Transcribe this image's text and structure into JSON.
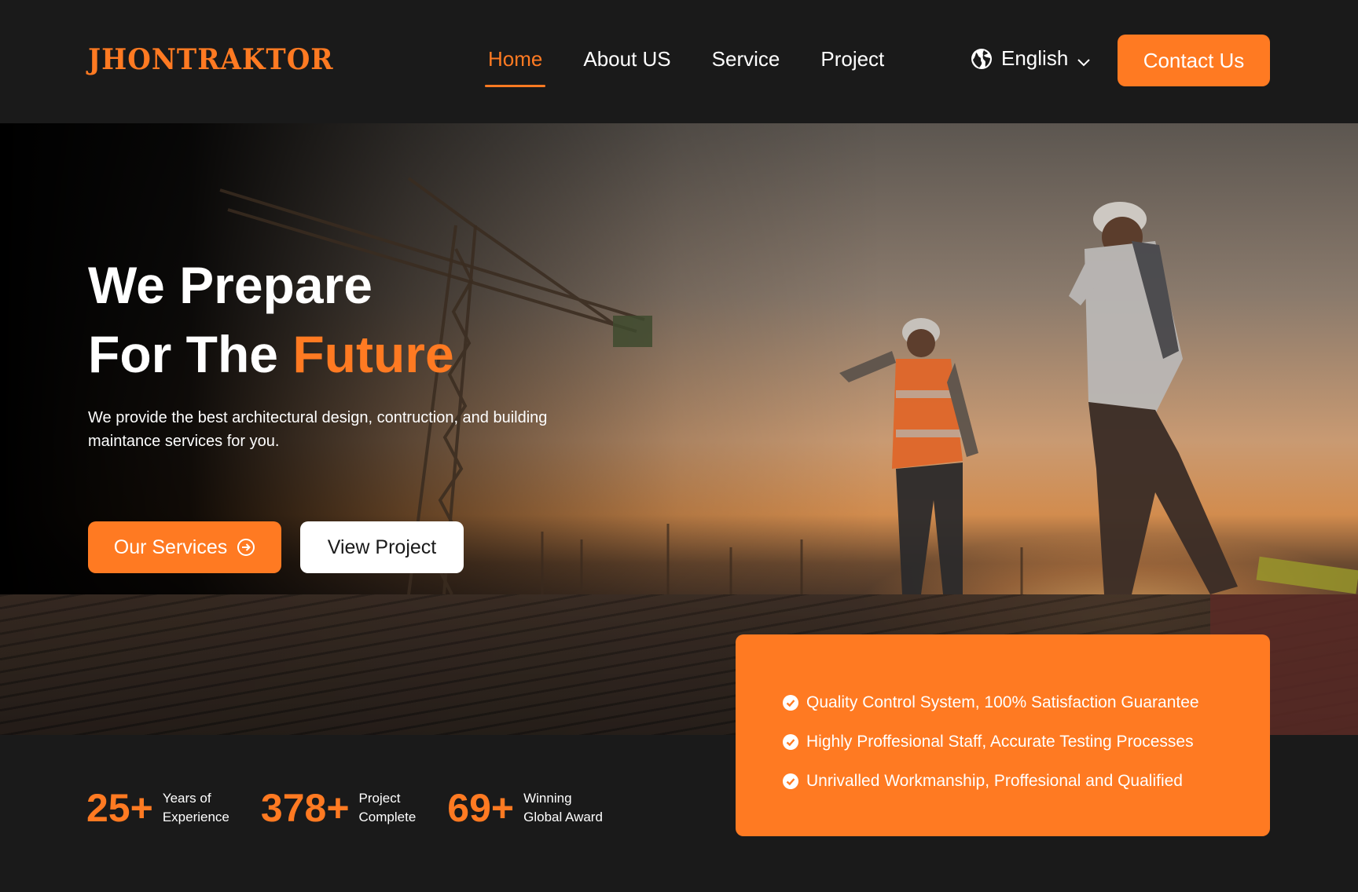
{
  "brand": {
    "logo": "JHONTRAKTOR",
    "accent_color": "#ff7a22",
    "background_color": "#1a1a1a"
  },
  "nav": {
    "items": [
      {
        "label": "Home",
        "active": true
      },
      {
        "label": "About US",
        "active": false
      },
      {
        "label": "Service",
        "active": false
      },
      {
        "label": "Project",
        "active": false
      }
    ]
  },
  "language": {
    "icon": "globe-icon",
    "label": "English",
    "dropdown_icon": "chevron-down-icon"
  },
  "header": {
    "contact_label": "Contact Us"
  },
  "hero": {
    "title_line1": "We Prepare",
    "title_line2_prefix": "For The ",
    "title_line2_accent": "Future",
    "description": "We provide the best architectural design, contruction, and building maintance services for you.",
    "primary_button": "Our Services",
    "primary_button_icon": "arrow-right-circle-icon",
    "secondary_button": "View Project"
  },
  "stats": [
    {
      "value": "25+",
      "label_line1": "Years of",
      "label_line2": "Experience"
    },
    {
      "value": "378+",
      "label_line1": "Project",
      "label_line2": "Complete"
    },
    {
      "value": "69+",
      "label_line1": "Winning",
      "label_line2": "Global Award"
    }
  ],
  "features": [
    "Quality Control System, 100% Satisfaction Guarantee",
    "Highly Proffesional Staff, Accurate Testing Processes",
    "Unrivalled Workmanship, Proffesional and Qualified"
  ]
}
